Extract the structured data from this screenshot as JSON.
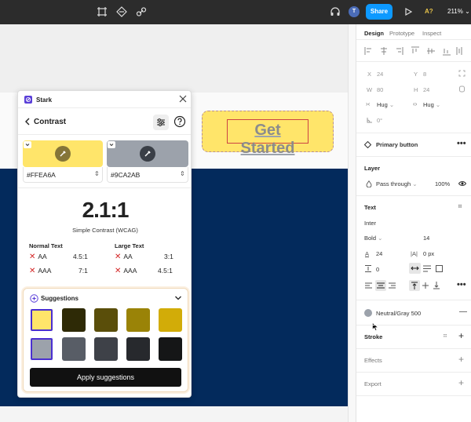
{
  "topbar": {
    "avatar_initial": "T",
    "share_label": "Share",
    "lang_badge": "A?",
    "zoom": "211%",
    "zoom_caret": "⌄"
  },
  "canvas": {
    "button_text": "Get Started"
  },
  "plugin": {
    "title": "Stark",
    "section_title": "Contrast",
    "foreground": {
      "hex": "#FFEA6A",
      "color": "#ffe56a"
    },
    "background": {
      "hex": "#9CA2AB",
      "color": "#9ca2ab"
    },
    "ratio": "2.1:1",
    "ratio_caption": "Simple Contrast (WCAG)",
    "normal_text": {
      "heading": "Normal Text",
      "rows": [
        {
          "level": "AA",
          "req": "4.5:1"
        },
        {
          "level": "AAA",
          "req": "7:1"
        }
      ]
    },
    "large_text": {
      "heading": "Large Text",
      "rows": [
        {
          "level": "AA",
          "req": "3:1"
        },
        {
          "level": "AAA",
          "req": "4.5:1"
        }
      ]
    },
    "fail_mark": "✕",
    "suggestions_label": "Suggestions",
    "suggestions_row1": [
      "#ffe56a",
      "#2e2a06",
      "#5a4e0a",
      "#9a8307",
      "#d2ac08"
    ],
    "suggestions_row2": [
      "#9ca2ab",
      "#585d66",
      "#3e4148",
      "#27292d",
      "#151617"
    ],
    "apply_label": "Apply suggestions"
  },
  "panel": {
    "tabs": [
      "Design",
      "Prototype",
      "Inspect"
    ],
    "x_label": "X",
    "x_value": "24",
    "y_label": "Y",
    "y_value": "8",
    "w_label": "W",
    "w_value": "80",
    "h_label": "H",
    "h_value": "24",
    "hug_w": "Hug",
    "hug_h": "Hug",
    "rotation": "0°",
    "component_name": "Primary button",
    "layer_heading": "Layer",
    "blend_mode": "Pass through",
    "opacity": "100%",
    "text_heading": "Text",
    "font_family": "Inter",
    "font_weight": "Bold",
    "font_size": "14",
    "line_height": "24",
    "letter_spacing": "0 px",
    "paragraph_spacing": "0",
    "fill_style": "Neutral/Gray 500",
    "fill_color": "#9ca2ab",
    "stroke_heading": "Stroke",
    "effects_heading": "Effects",
    "export_heading": "Export"
  }
}
